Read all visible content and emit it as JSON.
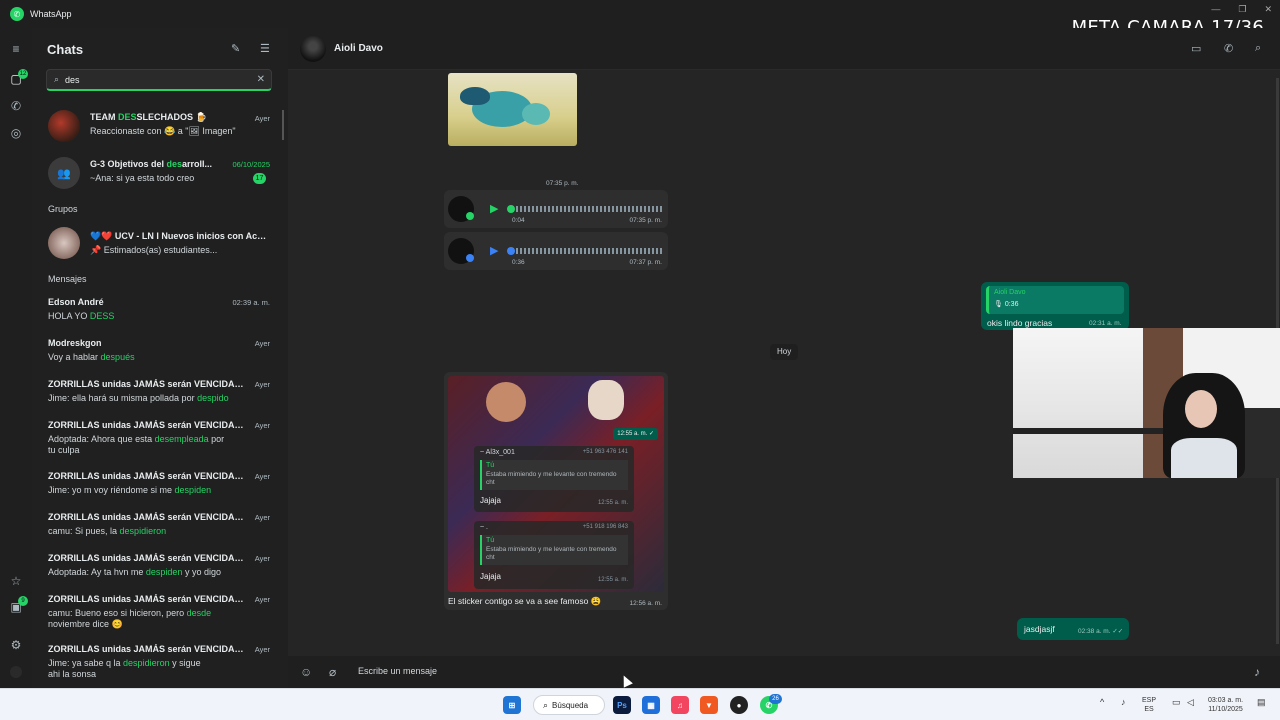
{
  "window": {
    "title": "WhatsApp"
  },
  "overlay": {
    "text": "META CAMARA 17/36"
  },
  "rail": {
    "chats_badge": "12",
    "updates_badge": "9"
  },
  "sidebar": {
    "title": "Chats",
    "search": {
      "value": "des"
    },
    "top_results": [
      {
        "name_pre": "TEAM ",
        "name_hl": "DES",
        "name_post": "SLECHADOS 🍺",
        "message": "Reaccionaste con 😂 a \"🖼 Imagen\"",
        "time": "Ayer"
      },
      {
        "name_pre": "G-3 Objetivos del ",
        "name_hl": "des",
        "name_post": "arroll...",
        "message": "~Ana: si ya esta todo creo",
        "time": "06/10/2025",
        "unread": "17"
      }
    ],
    "groups_label": "Grupos",
    "group_result": {
      "name": "💙❤️ UCV - LN I Nuevos inicios con Aco...",
      "message": "📌 Estimados(as) estudiantes..."
    },
    "messages_label": "Mensajes",
    "messages": [
      {
        "name": "Edson André",
        "time": "02:39 a. m.",
        "pre": "HOLA YO ",
        "hl": "DESS",
        "post": "",
        "line2": ""
      },
      {
        "name": "Modreskgon",
        "time": "Ayer",
        "pre": "Voy a hablar ",
        "hl": "después",
        "post": "",
        "line2": ""
      },
      {
        "name": "ZORRILLAS unidas JAMÁS serán VENCIDAS...",
        "time": "Ayer",
        "pre": "Jime: ella hará su misma pollada por ",
        "hl": "despido",
        "post": "",
        "line2": ""
      },
      {
        "name": "ZORRILLAS unidas JAMÁS serán VENCIDAS...",
        "time": "Ayer",
        "pre": "Adoptada: Ahora que esta ",
        "hl": "desempleada",
        "post": " por",
        "line2": "tu culpa"
      },
      {
        "name": "ZORRILLAS unidas JAMÁS serán VENCIDAS...",
        "time": "Ayer",
        "pre": "Jime: yo m voy riéndome si me ",
        "hl": "despiden",
        "post": "",
        "line2": ""
      },
      {
        "name": "ZORRILLAS unidas JAMÁS serán VENCIDAS...",
        "time": "Ayer",
        "pre": "camu: Si pues, la ",
        "hl": "despidieron",
        "post": "",
        "line2": ""
      },
      {
        "name": "ZORRILLAS unidas JAMÁS serán VENCIDAS...",
        "time": "Ayer",
        "pre": "Adoptada: Ay ta hvn me ",
        "hl": "despiden",
        "post": " y yo digo",
        "line2": ""
      },
      {
        "name": "ZORRILLAS unidas JAMÁS serán VENCIDAS...",
        "time": "Ayer",
        "pre": "camu: Bueno eso si hicieron, pero ",
        "hl": "desde",
        "post": "",
        "line2": "noviembre dice 😊"
      },
      {
        "name": "ZORRILLAS unidas JAMÁS serán VENCIDAS...",
        "time": "Ayer",
        "pre": "Jime: ya sabe q la ",
        "hl": "despidieron",
        "post": " y sigue",
        "line2": "ahi la sonsa"
      }
    ]
  },
  "chat": {
    "contact_name": "Aioli Davo",
    "timestamp_divider": "07:35 p. m.",
    "voice_notes": [
      {
        "duration": "0:04",
        "time": "07:35 p. m."
      },
      {
        "duration": "0:36",
        "time": "07:37 p. m."
      }
    ],
    "day_divider": "Hoy",
    "reply_bubble": {
      "quoted_name": "Aioli Davo",
      "quoted_text": "🎙 0:36",
      "text": "okis lindo gracias",
      "time": "02:31 a. m."
    },
    "image_message": {
      "caption": "El sticker contigo se va a see famoso 😩",
      "time": "12:56 a. m.",
      "inner_time": "12:55 a. m. ✓",
      "quote1": {
        "sender": "~ Al3x_001",
        "phone": "+51 963 476 141",
        "quoted_name": "Tú",
        "quoted_text": "Estaba mimiendo y me levante con tremendo cht",
        "reply": "Jajaja",
        "time": "12:55 a. m."
      },
      "quote2": {
        "sender": "~ .",
        "phone": "+51 918 196 843",
        "quoted_name": "Tú",
        "quoted_text": "Estaba mimiendo y me levante con tremendo cht",
        "reply": "Jajaja",
        "time": "12:55 a. m."
      }
    },
    "last_out": {
      "text": "jasdjasjf",
      "time": "02:38 a. m. ✓✓"
    },
    "composer_placeholder": "Escribe un mensaje"
  },
  "taskbar": {
    "search_label": "Búsqueda",
    "whatsapp_badge": "26",
    "lang": "ESP",
    "lang2": "ES",
    "time": "03:03 a. m.",
    "date": "11/10/2025"
  },
  "colors": {
    "accent": "#25d366",
    "outgoing": "#005c4b",
    "incoming": "#2e2e2e"
  }
}
